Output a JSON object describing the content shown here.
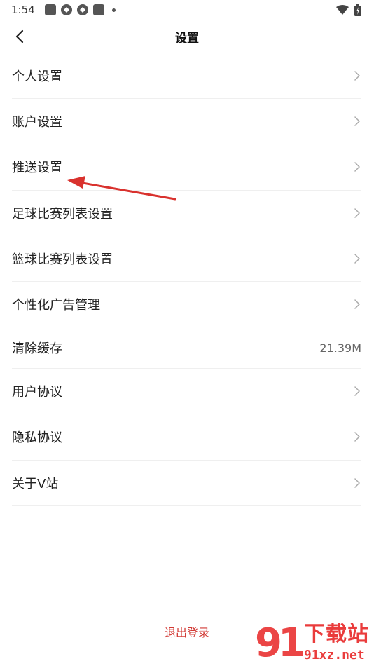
{
  "status_bar": {
    "time": "1:54",
    "icons": [
      "app-square-icon",
      "app-round-icon",
      "app-round-icon",
      "app-square-icon",
      "dot-icon",
      "wifi-icon",
      "battery-icon"
    ]
  },
  "header": {
    "title": "设置",
    "back_icon": "chevron-left-icon"
  },
  "settings": {
    "items": [
      {
        "label": "个人设置",
        "right": "chevron-right-icon"
      },
      {
        "label": "账户设置",
        "right": "chevron-right-icon"
      },
      {
        "label": "推送设置",
        "right": "chevron-right-icon"
      },
      {
        "label": "足球比赛列表设置",
        "right": "chevron-right-icon"
      },
      {
        "label": "篮球比赛列表设置",
        "right": "chevron-right-icon"
      },
      {
        "label": "个性化广告管理",
        "right": "chevron-right-icon"
      },
      {
        "label": "清除缓存",
        "value": "21.39M"
      },
      {
        "label": "用户协议",
        "right": "chevron-right-icon"
      },
      {
        "label": "隐私协议",
        "right": "chevron-right-icon"
      },
      {
        "label": "关于V站",
        "right": "chevron-right-icon"
      }
    ]
  },
  "logout": {
    "label": "退出登录"
  },
  "annotation": {
    "color": "#d9322e"
  },
  "watermark": {
    "number": "91",
    "text": "下载站",
    "domain": "91xz.net",
    "color": "#ea3c3c"
  }
}
